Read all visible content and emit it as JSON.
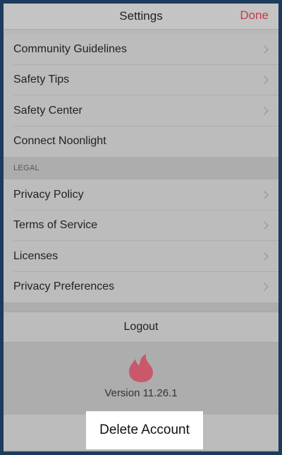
{
  "header": {
    "title": "Settings",
    "done_label": "Done",
    "done_color": "#c9384f"
  },
  "group1": {
    "items": [
      {
        "label": "Community Guidelines",
        "chevron": true
      },
      {
        "label": "Safety Tips",
        "chevron": true
      },
      {
        "label": "Safety Center",
        "chevron": true
      },
      {
        "label": "Connect Noonlight",
        "chevron": false
      }
    ]
  },
  "legal": {
    "section_label": "LEGAL",
    "items": [
      {
        "label": "Privacy Policy",
        "chevron": true
      },
      {
        "label": "Terms of Service",
        "chevron": true
      },
      {
        "label": "Licenses",
        "chevron": true
      },
      {
        "label": "Privacy Preferences",
        "chevron": true
      }
    ]
  },
  "logout_label": "Logout",
  "footer": {
    "logo_icon": "tinder-flame-icon",
    "logo_color": "#c9596a",
    "version": "Version 11.26.1"
  },
  "delete_account_label": "Delete Account"
}
